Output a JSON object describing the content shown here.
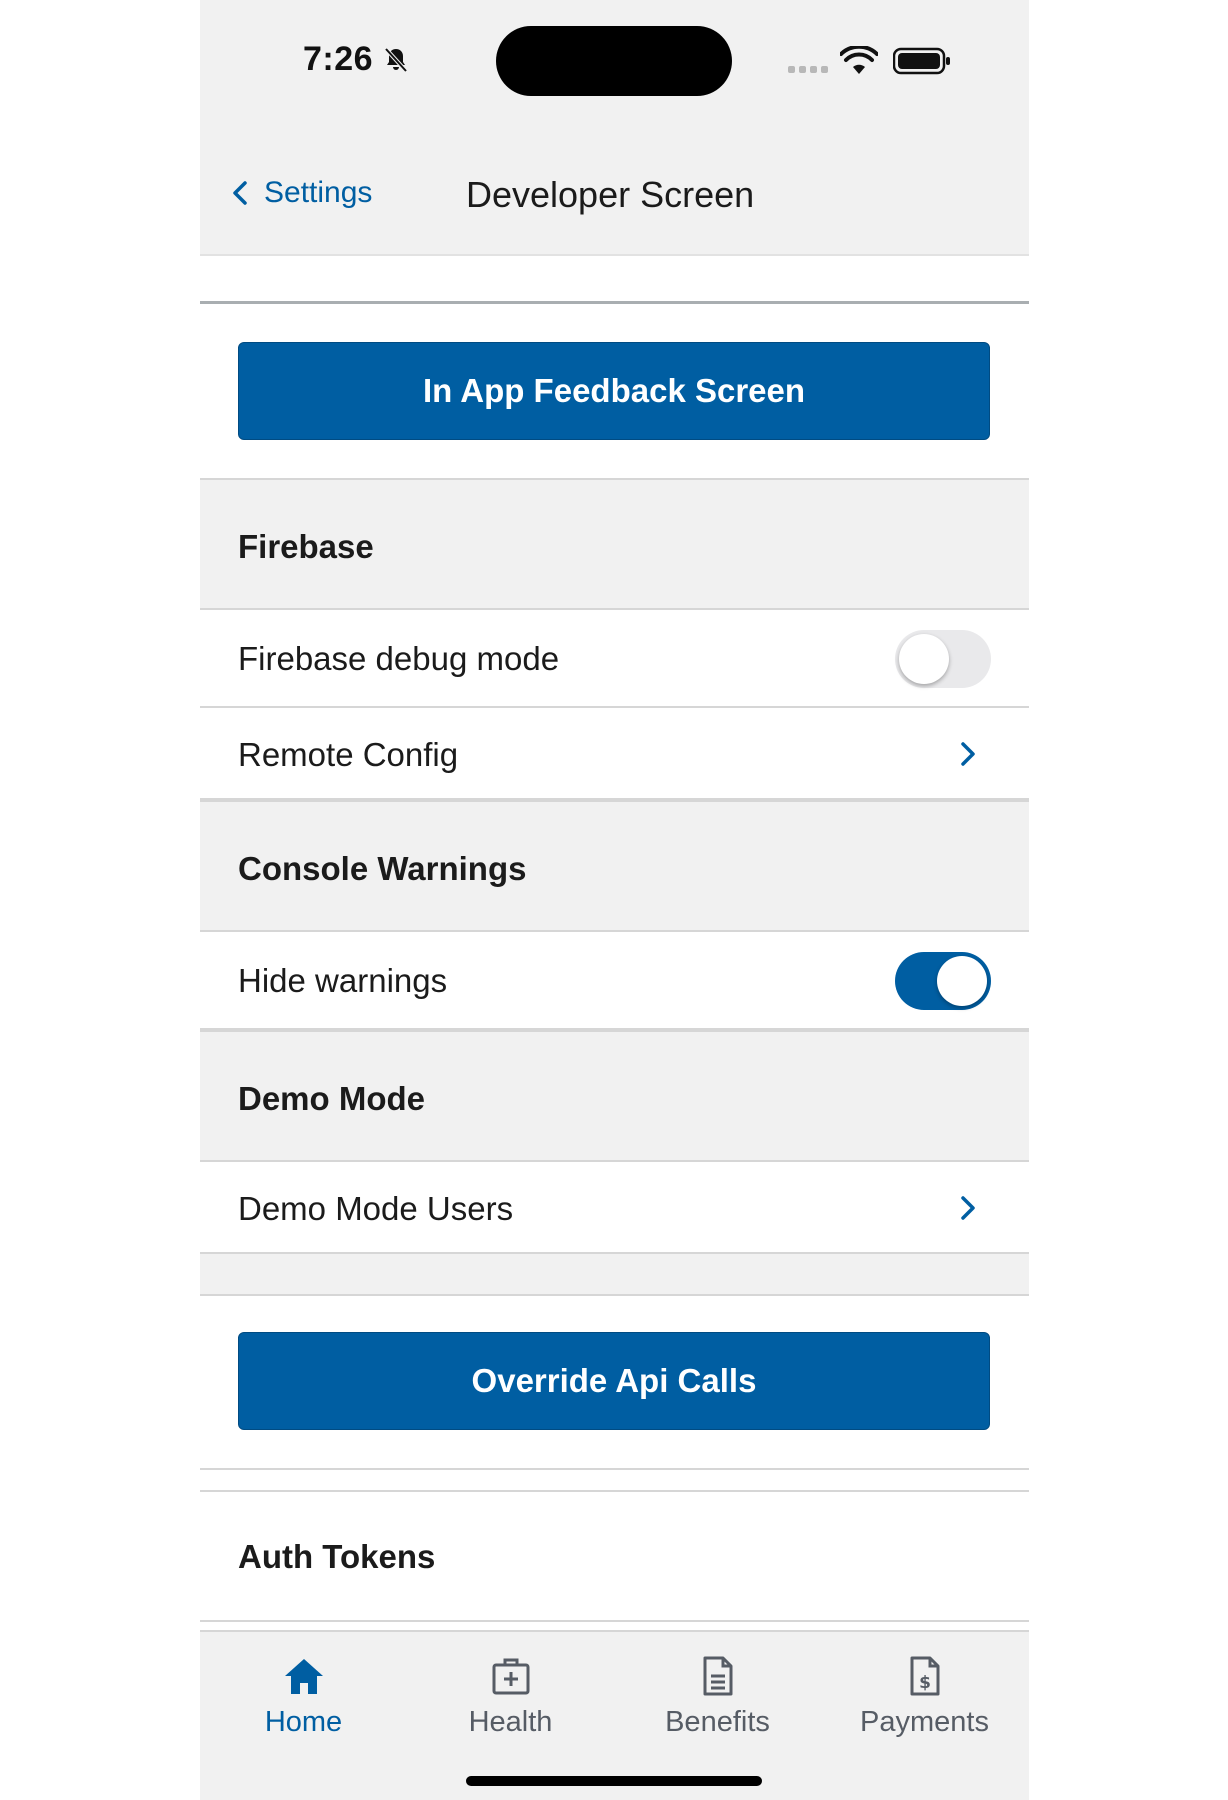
{
  "status_bar": {
    "time": "7:26"
  },
  "nav": {
    "back_label": "Settings",
    "title": "Developer Screen"
  },
  "buttons": {
    "feedback": "In App Feedback Screen",
    "override": "Override Api Calls"
  },
  "sections": {
    "firebase": {
      "title": "Firebase",
      "debug_label": "Firebase debug mode",
      "debug_on": false,
      "remote_label": "Remote Config"
    },
    "console": {
      "title": "Console Warnings",
      "hide_label": "Hide warnings",
      "hide_on": true
    },
    "demo": {
      "title": "Demo Mode",
      "users_label": "Demo Mode Users"
    },
    "auth": {
      "title": "Auth Tokens"
    }
  },
  "tabs": [
    {
      "label": "Home",
      "icon": "home-icon",
      "active": true
    },
    {
      "label": "Health",
      "icon": "medical-kit-icon",
      "active": false
    },
    {
      "label": "Benefits",
      "icon": "document-icon",
      "active": false
    },
    {
      "label": "Payments",
      "icon": "payment-document-icon",
      "active": false
    }
  ],
  "colors": {
    "primary": "#005ea2",
    "inactive_tab": "#565c65",
    "header_bg": "#f1f1f1"
  }
}
